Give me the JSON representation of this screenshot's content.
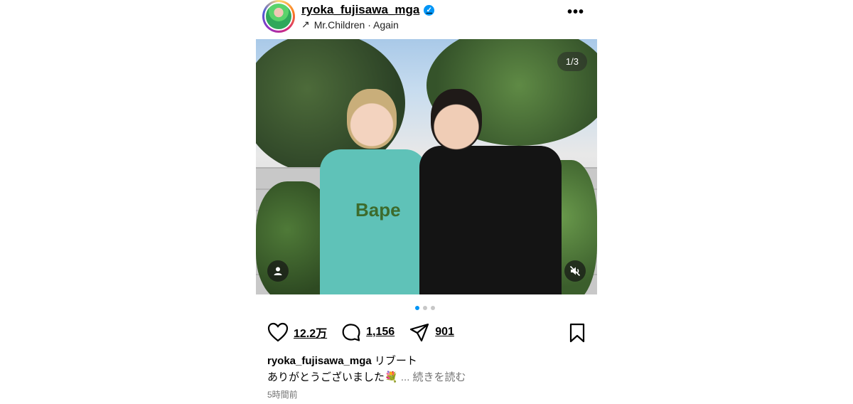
{
  "header": {
    "username": "ryoka_fujisawa_mga",
    "music_arrow": "↗",
    "music": "Mr.Children · Again",
    "more": "•••"
  },
  "media": {
    "counter": "1/3",
    "shirt_text": "Bape",
    "slide_index": 1,
    "slide_count": 3
  },
  "actions": {
    "likes": "12.2万",
    "comments": "1,156",
    "shares": "901"
  },
  "caption": {
    "username": "ryoka_fujisawa_mga",
    "suffix": "リブート",
    "text": "ありがとうございました💐",
    "ellipsis": "...",
    "more": "続きを読む"
  },
  "timestamp": "5時間前",
  "colors": {
    "accent": "#0095f6",
    "muted": "#737373"
  },
  "icons": [
    "verified-badge-icon",
    "music-arrow-icon",
    "more-icon",
    "user-tag-icon",
    "mute-icon",
    "heart-icon",
    "comment-icon",
    "share-icon",
    "bookmark-icon"
  ]
}
